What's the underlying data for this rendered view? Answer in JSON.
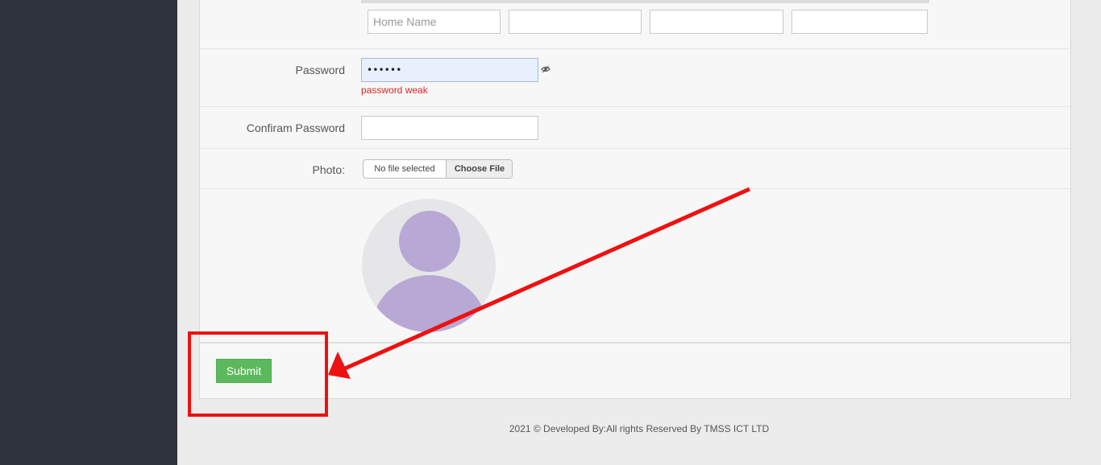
{
  "address": {
    "home_placeholder": "Home Name",
    "field2_placeholder": "",
    "field3_placeholder": "",
    "field4_placeholder": ""
  },
  "password": {
    "label": "Password",
    "value": "******",
    "strength_text": "password weak"
  },
  "confirm_password": {
    "label": "Confiram Password",
    "value": ""
  },
  "photo": {
    "label": "Photo:",
    "file_status": "No file selected",
    "choose_label": "Choose File"
  },
  "actions": {
    "submit_label": "Submit"
  },
  "footer": {
    "text": "2021 © Developed By:All rights Reserved By TMSS ICT LTD"
  },
  "colors": {
    "sidebar": "#2e333d",
    "submit": "#5cb85c",
    "error_text": "#e02424",
    "annotation": "#ee1111",
    "avatar_bg": "#e6e6e9",
    "avatar_figure": "#b8a8d4"
  },
  "icons": {
    "password_toggle": "eye-icon",
    "avatar": "user-avatar-placeholder"
  }
}
